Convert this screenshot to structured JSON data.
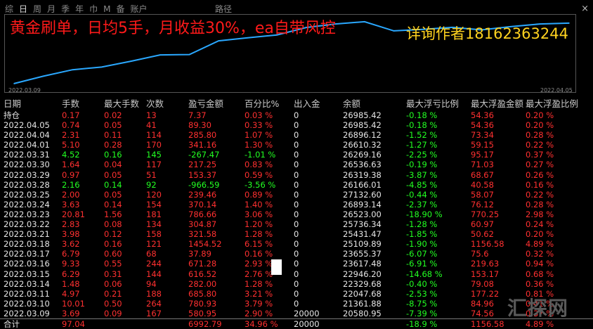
{
  "tabs": [
    {
      "label": "综",
      "active": false
    },
    {
      "label": "日",
      "active": true
    },
    {
      "label": "周",
      "active": false
    },
    {
      "label": "月",
      "active": false
    },
    {
      "label": "季",
      "active": false
    },
    {
      "label": "年",
      "active": false
    },
    {
      "label": "巾",
      "active": false
    },
    {
      "label": "M",
      "active": false
    },
    {
      "label": "备",
      "active": false
    },
    {
      "label": "账户",
      "active": false
    }
  ],
  "path_label": "路径",
  "close_icon": "×",
  "ad_left": "黄金刷单，日均5手，月收益30%，ea自带风控",
  "ad_right": "详询作者18162363244",
  "date_start": "2022.03.09",
  "date_end": "2022.04.05",
  "colors": {
    "profit": "#ff3030",
    "loss": "#22ff22",
    "equity_line": "#2aa8ff"
  },
  "headers": [
    "日期",
    "手数",
    "最大手数",
    "次数",
    "盈亏金额",
    "百分比%",
    "出入金",
    "余额",
    "最大浮亏比例",
    "最大浮盈金额",
    "最大浮盈比例"
  ],
  "rows": [
    {
      "date": "持仓",
      "lots": "0.17",
      "max_lots": "0.02",
      "count": "13",
      "pnl": "7.37",
      "pct": "0.03 %",
      "flow": "0",
      "balance": "26985.42",
      "max_dd": "-0.18 %",
      "max_float_profit": "54.36",
      "max_float_pct": "0.20 %",
      "pos": true
    },
    {
      "date": "2022.04.05",
      "lots": "0.74",
      "max_lots": "0.05",
      "count": "41",
      "pnl": "89.30",
      "pct": "0.33 %",
      "flow": "0",
      "balance": "26985.42",
      "max_dd": "-0.18 %",
      "max_float_profit": "54.36",
      "max_float_pct": "0.20 %",
      "pos": true
    },
    {
      "date": "2022.04.04",
      "lots": "2.31",
      "max_lots": "0.11",
      "count": "114",
      "pnl": "285.80",
      "pct": "1.07 %",
      "flow": "0",
      "balance": "26896.12",
      "max_dd": "-1.52 %",
      "max_float_profit": "73.34",
      "max_float_pct": "0.28 %",
      "pos": true
    },
    {
      "date": "2022.04.01",
      "lots": "5.10",
      "max_lots": "0.28",
      "count": "170",
      "pnl": "341.16",
      "pct": "1.30 %",
      "flow": "0",
      "balance": "26610.32",
      "max_dd": "-1.27 %",
      "max_float_profit": "59.15",
      "max_float_pct": "0.22 %",
      "pos": true
    },
    {
      "date": "2022.03.31",
      "lots": "4.52",
      "max_lots": "0.16",
      "count": "145",
      "pnl": "-267.47",
      "pct": "-1.01 %",
      "flow": "0",
      "balance": "26269.16",
      "max_dd": "-2.25 %",
      "max_float_profit": "95.17",
      "max_float_pct": "0.37 %",
      "pos": false
    },
    {
      "date": "2022.03.30",
      "lots": "1.64",
      "max_lots": "0.04",
      "count": "117",
      "pnl": "217.25",
      "pct": "0.83 %",
      "flow": "0",
      "balance": "26536.63",
      "max_dd": "-0.19 %",
      "max_float_profit": "71.03",
      "max_float_pct": "0.27 %",
      "pos": true
    },
    {
      "date": "2022.03.29",
      "lots": "0.97",
      "max_lots": "0.05",
      "count": "51",
      "pnl": "153.37",
      "pct": "0.59 %",
      "flow": "0",
      "balance": "26319.38",
      "max_dd": "-3.87 %",
      "max_float_profit": "68.67",
      "max_float_pct": "0.26 %",
      "pos": true
    },
    {
      "date": "2022.03.28",
      "lots": "2.16",
      "max_lots": "0.14",
      "count": "92",
      "pnl": "-966.59",
      "pct": "-3.56 %",
      "flow": "0",
      "balance": "26166.01",
      "max_dd": "-4.85 %",
      "max_float_profit": "40.58",
      "max_float_pct": "0.16 %",
      "pos": false
    },
    {
      "date": "2022.03.25",
      "lots": "2.00",
      "max_lots": "0.05",
      "count": "120",
      "pnl": "239.46",
      "pct": "0.89 %",
      "flow": "0",
      "balance": "27132.60",
      "max_dd": "-0.44 %",
      "max_float_profit": "58.07",
      "max_float_pct": "0.22 %",
      "pos": true
    },
    {
      "date": "2022.03.24",
      "lots": "3.63",
      "max_lots": "0.14",
      "count": "154",
      "pnl": "370.14",
      "pct": "1.40 %",
      "flow": "0",
      "balance": "26893.14",
      "max_dd": "-2.37 %",
      "max_float_profit": "76.12",
      "max_float_pct": "0.28 %",
      "pos": true
    },
    {
      "date": "2022.03.23",
      "lots": "20.81",
      "max_lots": "1.56",
      "count": "181",
      "pnl": "786.66",
      "pct": "3.06 %",
      "flow": "0",
      "balance": "26523.00",
      "max_dd": "-18.90 %",
      "max_float_profit": "770.25",
      "max_float_pct": "2.98 %",
      "pos": true
    },
    {
      "date": "2022.03.22",
      "lots": "2.83",
      "max_lots": "0.08",
      "count": "134",
      "pnl": "304.87",
      "pct": "1.20 %",
      "flow": "0",
      "balance": "25736.34",
      "max_dd": "-1.28 %",
      "max_float_profit": "60.97",
      "max_float_pct": "0.24 %",
      "pos": true
    },
    {
      "date": "2022.03.21",
      "lots": "3.98",
      "max_lots": "0.12",
      "count": "158",
      "pnl": "321.58",
      "pct": "1.28 %",
      "flow": "0",
      "balance": "25431.47",
      "max_dd": "-1.85 %",
      "max_float_profit": "50.62",
      "max_float_pct": "0.20 %",
      "pos": true
    },
    {
      "date": "2022.03.18",
      "lots": "3.62",
      "max_lots": "0.16",
      "count": "121",
      "pnl": "1454.52",
      "pct": "6.15 %",
      "flow": "0",
      "balance": "25109.89",
      "max_dd": "-1.90 %",
      "max_float_profit": "1156.58",
      "max_float_pct": "4.89 %",
      "pos": true
    },
    {
      "date": "2022.03.17",
      "lots": "6.79",
      "max_lots": "0.60",
      "count": "68",
      "pnl": "37.89",
      "pct": "0.16 %",
      "flow": "0",
      "balance": "23655.37",
      "max_dd": "-6.07 %",
      "max_float_profit": "75.6",
      "max_float_pct": "0.32 %",
      "pos": true
    },
    {
      "date": "2022.03.16",
      "lots": "9.33",
      "max_lots": "0.55",
      "count": "244",
      "pnl": "671.28",
      "pct": "2.93 %",
      "flow": "0",
      "balance": "23617.48",
      "max_dd": "-6.91 %",
      "max_float_profit": "219.63",
      "max_float_pct": "0.94 %",
      "pos": true
    },
    {
      "date": "2022.03.15",
      "lots": "6.29",
      "max_lots": "0.31",
      "count": "144",
      "pnl": "616.52",
      "pct": "2.76 %",
      "flow": "0",
      "balance": "22946.20",
      "max_dd": "-14.68 %",
      "max_float_profit": "153.17",
      "max_float_pct": "0.68 %",
      "pos": true
    },
    {
      "date": "2022.03.14",
      "lots": "1.48",
      "max_lots": "0.06",
      "count": "94",
      "pnl": "282.00",
      "pct": "1.28 %",
      "flow": "0",
      "balance": "22329.68",
      "max_dd": "-0.40 %",
      "max_float_profit": "79.08",
      "max_float_pct": "0.36 %",
      "pos": true
    },
    {
      "date": "2022.03.11",
      "lots": "4.97",
      "max_lots": "0.21",
      "count": "188",
      "pnl": "685.80",
      "pct": "3.21 %",
      "flow": "0",
      "balance": "22047.68",
      "max_dd": "-2.53 %",
      "max_float_profit": "177.22",
      "max_float_pct": "0.81 %",
      "pos": true
    },
    {
      "date": "2022.03.10",
      "lots": "10.01",
      "max_lots": "0.50",
      "count": "264",
      "pnl": "780.93",
      "pct": "3.79 %",
      "flow": "0",
      "balance": "21361.88",
      "max_dd": "-8.75 %",
      "max_float_profit": "84.96",
      "max_float_pct": "0.41 %",
      "pos": true
    },
    {
      "date": "2022.03.09",
      "lots": "3.69",
      "max_lots": "0.09",
      "count": "167",
      "pnl": "580.95",
      "pct": "2.90 %",
      "flow": "20000",
      "balance": "20580.95",
      "max_dd": "-7.39 %",
      "max_float_profit": "74.56",
      "max_float_pct": "0.37 %",
      "pos": true
    }
  ],
  "total": {
    "date": "合计",
    "lots": "97.04",
    "max_lots": "",
    "count": "",
    "pnl": "6992.79",
    "pct": "34.96 %",
    "flow": "20000",
    "balance": "",
    "max_dd": "-18.9 %",
    "max_float_profit": "1156.58",
    "max_float_pct": "4.89 %"
  },
  "watermark": "汇探网",
  "chart_data": {
    "type": "line",
    "x": [
      "2022.03.09",
      "2022.03.10",
      "2022.03.11",
      "2022.03.14",
      "2022.03.15",
      "2022.03.16",
      "2022.03.17",
      "2022.03.18",
      "2022.03.21",
      "2022.03.22",
      "2022.03.23",
      "2022.03.24",
      "2022.03.25",
      "2022.03.28",
      "2022.03.29",
      "2022.03.30",
      "2022.03.31",
      "2022.04.01",
      "2022.04.04",
      "2022.04.05"
    ],
    "values": [
      20580.95,
      21361.88,
      22047.68,
      22329.68,
      22946.2,
      23617.48,
      23655.37,
      25109.89,
      25431.47,
      25736.34,
      26523.0,
      26893.14,
      27132.6,
      26166.01,
      26319.38,
      26536.63,
      26269.16,
      26610.32,
      26896.12,
      26985.42
    ],
    "xlabel": "",
    "ylabel": "",
    "ylim": [
      20200,
      27500
    ],
    "grid": false,
    "title": ""
  }
}
